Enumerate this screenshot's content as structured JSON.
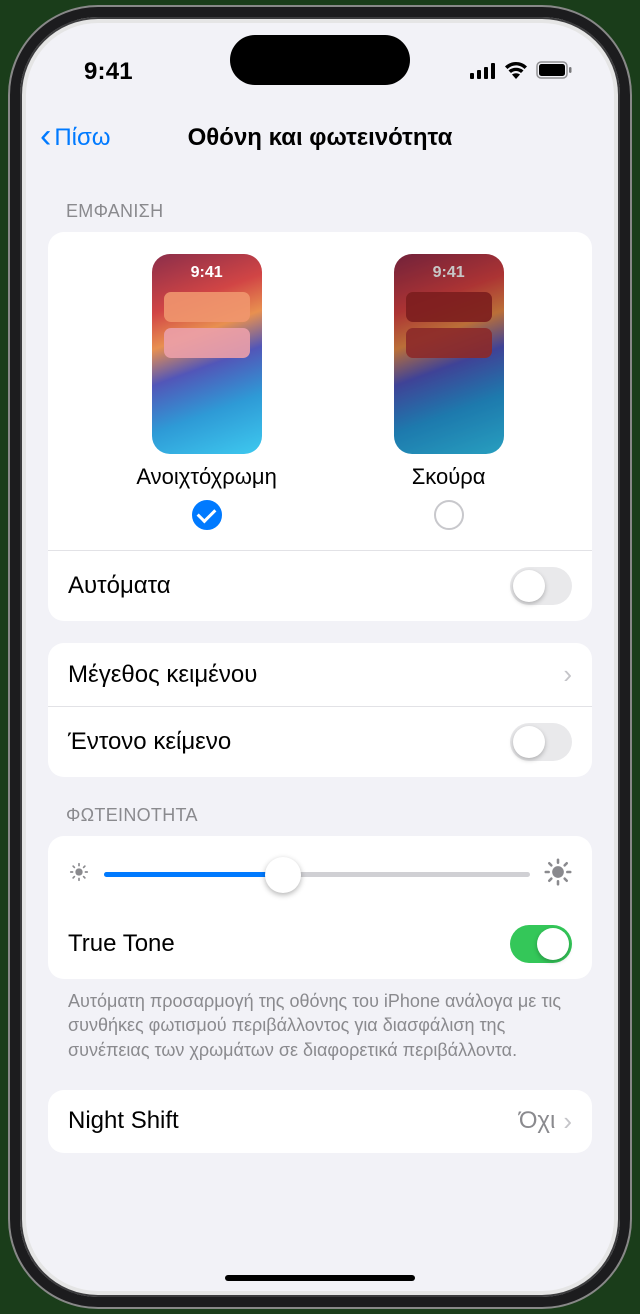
{
  "status": {
    "time": "9:41"
  },
  "nav": {
    "back": "Πίσω",
    "title": "Οθόνη και φωτεινότητα"
  },
  "appearance": {
    "header": "ΕΜΦΑΝΙΣΗ",
    "preview_time": "9:41",
    "light_label": "Ανοιχτόχρωμη",
    "dark_label": "Σκούρα",
    "selected": "light",
    "automatic_label": "Αυτόματα",
    "automatic_on": false
  },
  "text_group": {
    "text_size_label": "Μέγεθος κειμένου",
    "bold_label": "Έντονο κείμενο",
    "bold_on": false
  },
  "brightness": {
    "header": "ΦΩΤΕΙΝΟΤΗΤΑ",
    "value_percent": 42,
    "truetone_label": "True Tone",
    "truetone_on": true,
    "truetone_footer": "Αυτόματη προσαρμογή της οθόνης του iPhone ανάλογα με τις συνθήκες φωτισμού περιβάλλοντος για διασφάλιση της συνέπειας των χρωμάτων σε διαφορετικά περιβάλλοντα."
  },
  "nightshift": {
    "label": "Night Shift",
    "value": "Όχι"
  }
}
